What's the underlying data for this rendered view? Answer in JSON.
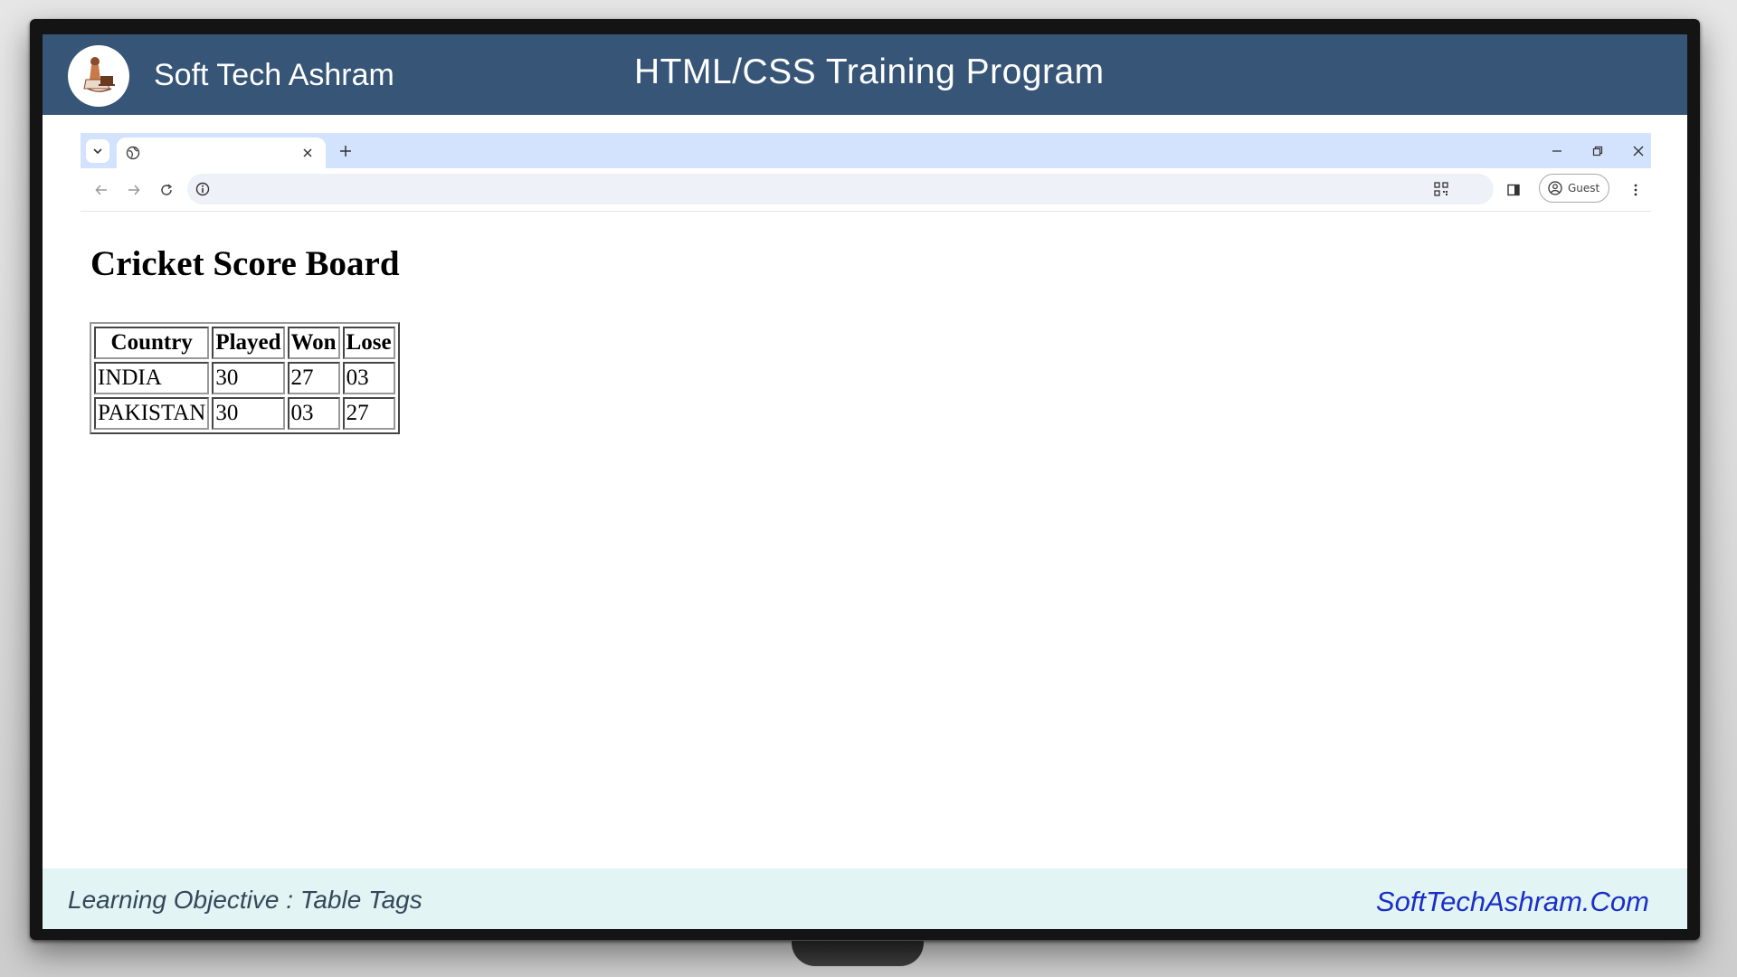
{
  "header": {
    "brand": "Soft Tech Ashram",
    "program_title": "HTML/CSS Training Program"
  },
  "browser": {
    "tab": {
      "title": "",
      "close_glyph": "×"
    },
    "new_tab_glyph": "+",
    "omnibox_url": "",
    "profile_label": "Guest",
    "icons": [
      "tab-search-icon",
      "globe-icon",
      "close-icon",
      "plus-icon",
      "minimize-icon",
      "restore-icon",
      "window-close-icon",
      "back-arrow-icon",
      "forward-arrow-icon",
      "reload-icon",
      "info-icon",
      "qr-code-icon",
      "side-panel-icon",
      "profile-icon",
      "more-menu-icon"
    ]
  },
  "page": {
    "heading": "Cricket Score Board",
    "table": {
      "headers": [
        "Country",
        "Played",
        "Won",
        "Lose"
      ],
      "rows": [
        [
          "INDIA",
          "30",
          "27",
          "03"
        ],
        [
          "PAKISTAN",
          "30",
          "03",
          "27"
        ]
      ]
    }
  },
  "footer": {
    "objective": "Learning Objective : Table Tags",
    "site": "SoftTechAshram.Com"
  },
  "colors": {
    "header_bg": "#365577",
    "tabstrip_bg": "#d3e3fd",
    "footer_bg": "#e2f4f3",
    "site_link": "#1b2fc8"
  }
}
